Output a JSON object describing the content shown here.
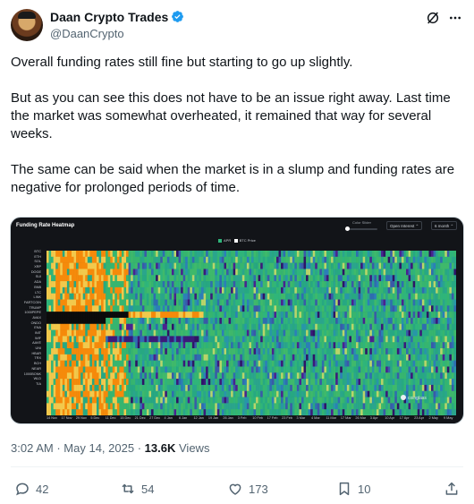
{
  "author": {
    "name": "Daan Crypto Trades",
    "handle": "@DaanCrypto"
  },
  "tweet": {
    "paragraphs": [
      "Overall funding rates still fine but starting to go up slightly.",
      "But as you can see this does not have to be an issue right away. Last time the market was somewhat overheated, it remained that way for several weeks.",
      "The same can be said when the market is in a slump and funding rates are negative for prolonged periods of time."
    ]
  },
  "heatmap": {
    "title": "Funding Rate Heatmap",
    "slider_label": "Color Slider",
    "select_open_interest": "Open Interest",
    "select_period": "6 month",
    "legend": [
      "APR",
      "BTC Price"
    ],
    "watermark": "coinglass",
    "coins": [
      "BTC",
      "ETH",
      "SOL",
      "XRP",
      "DOGE",
      "SUI",
      "ADA",
      "BNB",
      "LTC",
      "LINK",
      "FARTCOIN",
      "TRUMP",
      "1000PEPE",
      "AVAX",
      "ONDO",
      "ENA",
      "INIT",
      "WIF",
      "AAVE",
      "UNI",
      "HBAR",
      "TRX",
      "BCH",
      "NEAR",
      "1000BONK",
      "WLD",
      "TIA"
    ],
    "dates": [
      "14 Nov",
      "17 Nov",
      "20 Nov",
      "23 Nov",
      "26 Nov",
      "29 Nov",
      "2 Dec",
      "5 Dec",
      "8 Dec",
      "11 Dec",
      "14 Dec",
      "17 Dec",
      "20 Dec",
      "23 Dec",
      "26 Dec",
      "29 Dec",
      "1 Jan",
      "4 Jan",
      "7 Jan",
      "10 Jan",
      "13 Jan",
      "16 Jan",
      "19 Jan",
      "22 Jan",
      "25 Jan",
      "28 Jan",
      "31 Jan",
      "3 Feb",
      "6 Feb",
      "9 Feb",
      "12 Feb",
      "15 Feb",
      "18 Feb",
      "21 Feb",
      "24 Feb",
      "27 Feb",
      "2 Mar",
      "5 Mar",
      "8 Mar",
      "11 Mar",
      "14 Mar",
      "17 Mar",
      "20 Mar",
      "23 Mar",
      "26 Mar",
      "29 Mar",
      "1 Apr",
      "4 Apr",
      "7 Apr",
      "10 Apr",
      "13 Apr",
      "16 Apr",
      "19 Apr",
      "22 Apr",
      "25 Apr",
      "28 Apr",
      "1 May",
      "4 May",
      "7 May",
      "10 May",
      "13 May"
    ],
    "visible_date_labels": [
      "14 Nov",
      "17 Nov",
      "29 Nov",
      "5 Dec",
      "11 Dec",
      "15 Dec",
      "21 Dec",
      "27 Dec",
      "4 Jan",
      "6 Jan",
      "12 Jan",
      "19 Jan",
      "26 Jan",
      "3 Feb",
      "10 Feb",
      "17 Feb",
      "23 Feb",
      "3 Mar",
      "4 Mar",
      "11 Mar",
      "17 Mar",
      "26 Mar",
      "3 Apr",
      "10 Apr",
      "17 Apr",
      "23 Apr",
      "2 May",
      "9 May"
    ],
    "colors": {
      "hot": "#f58a0b",
      "warm": "#f2c94c",
      "neutral": "#2fb57a",
      "cool": "#2c7fb8",
      "cold": "#3b1a7a",
      "null": "#0b0b0b"
    },
    "chart_data": {
      "type": "heatmap",
      "title": "Funding Rate Heatmap",
      "rows": "coins",
      "columns": "dates",
      "periods": [
        {
          "range": [
            "14 Nov",
            "4 Dec"
          ],
          "pattern": "mostly positive (orange/yellow) across all coins"
        },
        {
          "range": [
            "5 Dec",
            "13 May"
          ],
          "pattern": "mostly neutral (green) with scattered negative (blue/purple) streaks"
        }
      ],
      "notable_rows": {
        "FARTCOIN": "orange band after null section late Dec–Jan",
        "TRUMP": "dark blank section in early period",
        "ONDO": "purple/negative streak in early Dec"
      }
    }
  },
  "meta": {
    "time": "3:02 AM",
    "separator": "·",
    "date": "May 14, 2025",
    "views_count": "13.6K",
    "views_label": "Views"
  },
  "actions": {
    "replies": "42",
    "reposts": "54",
    "likes": "173",
    "bookmarks": "10"
  }
}
